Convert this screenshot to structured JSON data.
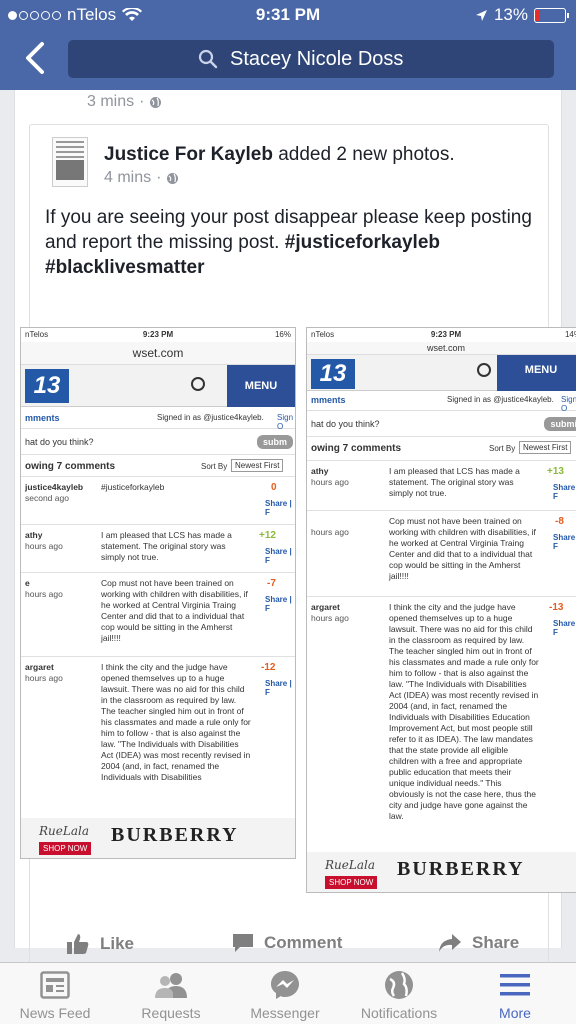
{
  "status_bar": {
    "carrier": "nTelos",
    "time": "9:31 PM",
    "battery": "13%"
  },
  "header": {
    "search_text": "Stacey Nicole Doss"
  },
  "post_meta": {
    "time": "3 mins"
  },
  "shared_post": {
    "page_name": "Justice For Kayleb",
    "action": "added 2 new photos.",
    "time": "4 mins",
    "text_plain": "If you are seeing your post disappear please keep posting and report the missing post.",
    "hashtag1": "#justiceforkayleb",
    "hashtag2": "#blacklivesmatter"
  },
  "screenshot_left": {
    "carrier": "nTelos",
    "time": "9:23 PM",
    "battery": "16%",
    "url": "wset.com",
    "menu": "MENU",
    "logo": "13",
    "section": "mments",
    "signed_in": "Signed in as @justice4kayleb.",
    "sign_link": "Sign O",
    "prompt": "hat do you think?",
    "submit": "subm",
    "showing": "owing 7 comments",
    "sort_by": "Sort By",
    "sort_value": "Newest First",
    "comments": [
      {
        "user": "justice4kayleb",
        "time": "second ago",
        "text": "#justiceforkayleb",
        "score": "0"
      },
      {
        "user": "athy",
        "time": "hours ago",
        "text": "I am pleased that LCS has made a statement. The original story was simply not true.",
        "score": "+12"
      },
      {
        "user": "e",
        "time": "hours ago",
        "text": "Cop must not have been trained on working with children with disabilities, if he worked at Central Virginia Traing Center and did that to a individual that cop would be sitting in the Amherst jail!!!!",
        "score": "-7"
      },
      {
        "user": "argaret",
        "time": "hours ago",
        "text": "I think the city and the judge have opened themselves up to a huge lawsuit. There was no aid for this child in the classroom as required by law. The teacher singled him out in front of his classmates and made a rule only for him to follow - that is also against the law. \"The Individuals with Disabilities Act (IDEA) was most recently revised in 2004 (and, in fact, renamed the Individuals with Disabilities",
        "score": "-12"
      }
    ],
    "share_label": "Share | F",
    "ad": {
      "brand_small": "RueLala",
      "shop_now": "SHOP NOW",
      "brand": "BURBERRY"
    }
  },
  "screenshot_right": {
    "carrier": "nTelos",
    "time": "9:23 PM",
    "battery": "14%",
    "url": "wset.com",
    "menu": "MENU",
    "logo": "13",
    "section": "mments",
    "signed_in": "Signed in as @justice4kayleb.",
    "sign_link": "Sign O",
    "prompt": "hat do you think?",
    "submit": "submi",
    "showing": "owing 7 comments",
    "sort_by": "Sort By",
    "sort_value": "Newest First",
    "comments": [
      {
        "user": "athy",
        "time": "hours ago",
        "text": "I am pleased that LCS has made a statement. The original story was simply not true.",
        "score": "+13"
      },
      {
        "user": "",
        "time": "hours ago",
        "text": "Cop must not have been trained on working with children with disabilities, if he worked at Central Virginia Traing Center and did that to a individual that cop would be sitting in the Amherst jail!!!!",
        "score": "-8"
      },
      {
        "user": "argaret",
        "time": "hours ago",
        "text": "I think the city and the judge have opened themselves up to a huge lawsuit. There was no aid for this child in the classroom as required by law. The teacher singled him out in front of his classmates and made a rule only for him to follow - that is also against the law. \"The Individuals with Disabilities Act (IDEA) was most recently revised in 2004 (and, in fact, renamed the Individuals with Disabilities Education Improvement Act, but most people still refer to it as IDEA). The law mandates that the state provide all eligible children with a free and appropriate public education that meets their unique individual needs.\" This obviously is not the case here, thus the city and judge have gone against the law.",
        "score": "-13"
      }
    ],
    "share_label": "Share | F",
    "ad": {
      "brand_small": "RueLala",
      "shop_now": "SHOP NOW",
      "brand": "BURBERRY"
    }
  },
  "actions": {
    "like": "Like",
    "comment": "Comment",
    "share": "Share"
  },
  "tabbar": {
    "news_feed": "News Feed",
    "requests": "Requests",
    "messenger": "Messenger",
    "notifications": "Notifications",
    "more": "More"
  },
  "colors": {
    "brand": "#4a67a8",
    "active_tab": "#4a67c0"
  }
}
